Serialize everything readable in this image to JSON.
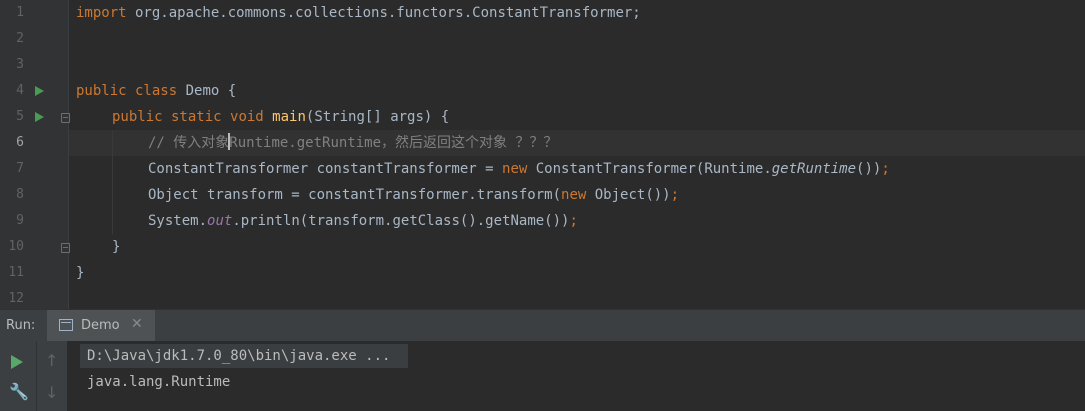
{
  "editor": {
    "line_numbers": [
      "1",
      "2",
      "3",
      "4",
      "5",
      "6",
      "7",
      "8",
      "9",
      "10",
      "11",
      "12"
    ],
    "code": {
      "l1_import": "import",
      "l1_pkg": " org.apache.commons.collections.functors.ConstantTransformer;",
      "l4_public": "public",
      "l4_class": " class",
      "l4_rest": " Demo {",
      "l5_public": "public",
      "l5_static": " static",
      "l5_void": " void",
      "l5_main": " main",
      "l5_rest": "(String[] args) {",
      "l6_comment_a": "// 传入对象",
      "l6_comment_b": "Runtime.getRuntime，然后返回这个对象 ？？？",
      "l7_a": "ConstantTransformer constantTransformer = ",
      "l7_new": "new",
      "l7_b": " ConstantTransformer(Runtime.",
      "l7_call": "getRuntime",
      "l7_c": "())",
      "l7_semi": ";",
      "l8_a": "Object transform = constantTransformer.transform(",
      "l8_new": "new",
      "l8_b": " Object())",
      "l8_semi": ";",
      "l9_a": "System.",
      "l9_out": "out",
      "l9_b": ".println(transform.getClass().getName())",
      "l9_semi": ";",
      "l10": "}",
      "l11": "}"
    }
  },
  "run_panel": {
    "label": "Run:",
    "tab_name": "Demo",
    "close_glyph": "✕",
    "command": "D:\\Java\\jdk1.7.0_80\\bin\\java.exe ...",
    "output": "java.lang.Runtime",
    "icons": {
      "run": "play-icon",
      "settings": "wrench-icon",
      "scroll_up": "arrow-up-icon",
      "scroll_down": "arrow-down-icon"
    }
  },
  "colors": {
    "background": "#2b2b2b",
    "keyword": "#cc7832",
    "method_decl": "#ffc66d",
    "comment": "#808080",
    "static_field": "#9876aa",
    "text": "#a9b7c6",
    "run_green": "#499c54"
  }
}
